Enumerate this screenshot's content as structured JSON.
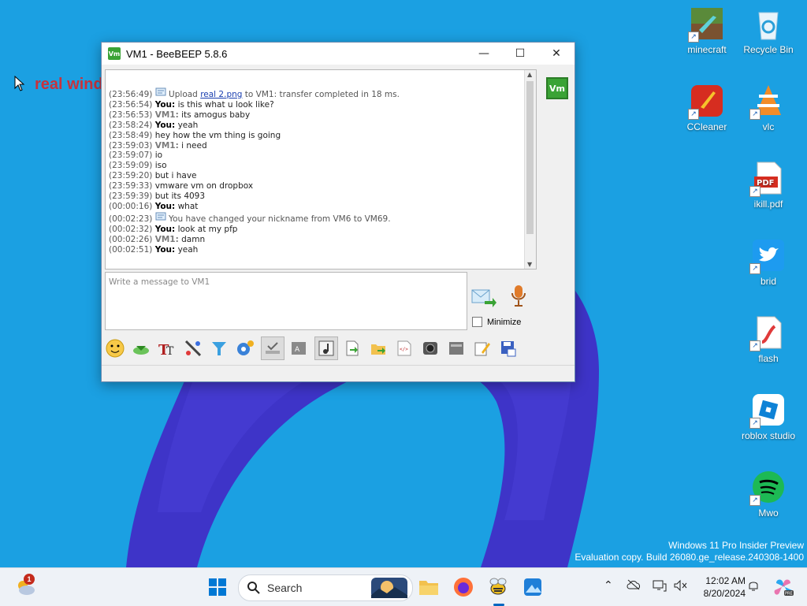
{
  "desktop": {
    "background_text": "real wind",
    "icons": [
      {
        "label": "minecraft",
        "icon": "minecraft-icon"
      },
      {
        "label": "Recycle Bin",
        "icon": "recycle-bin-icon"
      },
      {
        "label": "CCleaner",
        "icon": "ccleaner-icon"
      },
      {
        "label": "vlc",
        "icon": "vlc-icon"
      },
      {
        "label": "ikill.pdf",
        "icon": "pdf-icon"
      },
      {
        "label": "brid",
        "icon": "twitter-icon"
      },
      {
        "label": "flash",
        "icon": "flash-icon"
      },
      {
        "label": "roblox studio",
        "icon": "roblox-icon"
      },
      {
        "label": "Mwo",
        "icon": "spotify-icon"
      }
    ]
  },
  "window": {
    "title": "VM1 - BeeBEEP 5.8.6",
    "app_icon_text": "Vm",
    "controls": {
      "minimize": "—",
      "maximize": "☐",
      "close": "✕"
    },
    "chat": [
      {
        "ts": "(23:56:49)",
        "sender": "",
        "pre": "Upload ",
        "link": "real 2.png",
        "text": " to VM1: transfer completed in 18 ms."
      },
      {
        "ts": "(23:56:54)",
        "sender": "You:",
        "text": " is this what u look like?"
      },
      {
        "ts": "(23:56:53)",
        "sender": "VM1:",
        "text": " its amogus baby"
      },
      {
        "ts": "(23:58:24)",
        "sender": "You:",
        "text": " yeah"
      },
      {
        "ts": "(23:58:49)",
        "sender": "",
        "text": "hey how the vm thing is going"
      },
      {
        "ts": "(23:59:03)",
        "sender": "VM1:",
        "text": " i need"
      },
      {
        "ts": "(23:59:07)",
        "sender": "",
        "text": "io"
      },
      {
        "ts": "(23:59:09)",
        "sender": "",
        "text": "iso"
      },
      {
        "ts": "(23:59:20)",
        "sender": "",
        "text": "but i have"
      },
      {
        "ts": "(23:59:33)",
        "sender": "",
        "text": "vmware vm on dropbox"
      },
      {
        "ts": "(23:59:39)",
        "sender": "",
        "text": "but its 4093"
      },
      {
        "ts": "(00:00:16)",
        "sender": "You:",
        "text": " what"
      },
      {
        "ts": "(00:02:23)",
        "sender": "",
        "text": "You have changed your nickname from VM6 to VM69."
      },
      {
        "ts": "(00:02:32)",
        "sender": "You:",
        "text": " look at my pfp"
      },
      {
        "ts": "(00:02:26)",
        "sender": "VM1:",
        "text": " damn"
      },
      {
        "ts": "(00:02:51)",
        "sender": "You:",
        "text": " yeah"
      }
    ],
    "input_placeholder": "Write a message to VM1",
    "minimize_label": "Minimize",
    "user_badge": "Vm",
    "toolbar": [
      "emoji-icon",
      "download-icon",
      "font-icon",
      "color-icon",
      "filter-icon",
      "settings-icon",
      "spellcheck-icon",
      "word-complete-icon",
      "music-icon",
      "send-file-icon",
      "send-folder-icon",
      "html-icon",
      "screenshot-icon",
      "buzz-icon",
      "edit-icon",
      "save-icon"
    ]
  },
  "watermark": {
    "line1": "Windows 11 Pro Insider Preview",
    "line2": "Evaluation copy. Build 26080.ge_release.240308-1400"
  },
  "taskbar": {
    "search_label": "Search",
    "time": "12:02 AM",
    "date": "8/20/2024",
    "widget_badge": "1"
  },
  "colors": {
    "desktop_bg": "#1ba0e2",
    "accent": "#0067c0",
    "beebeep_green": "#3aa335"
  }
}
